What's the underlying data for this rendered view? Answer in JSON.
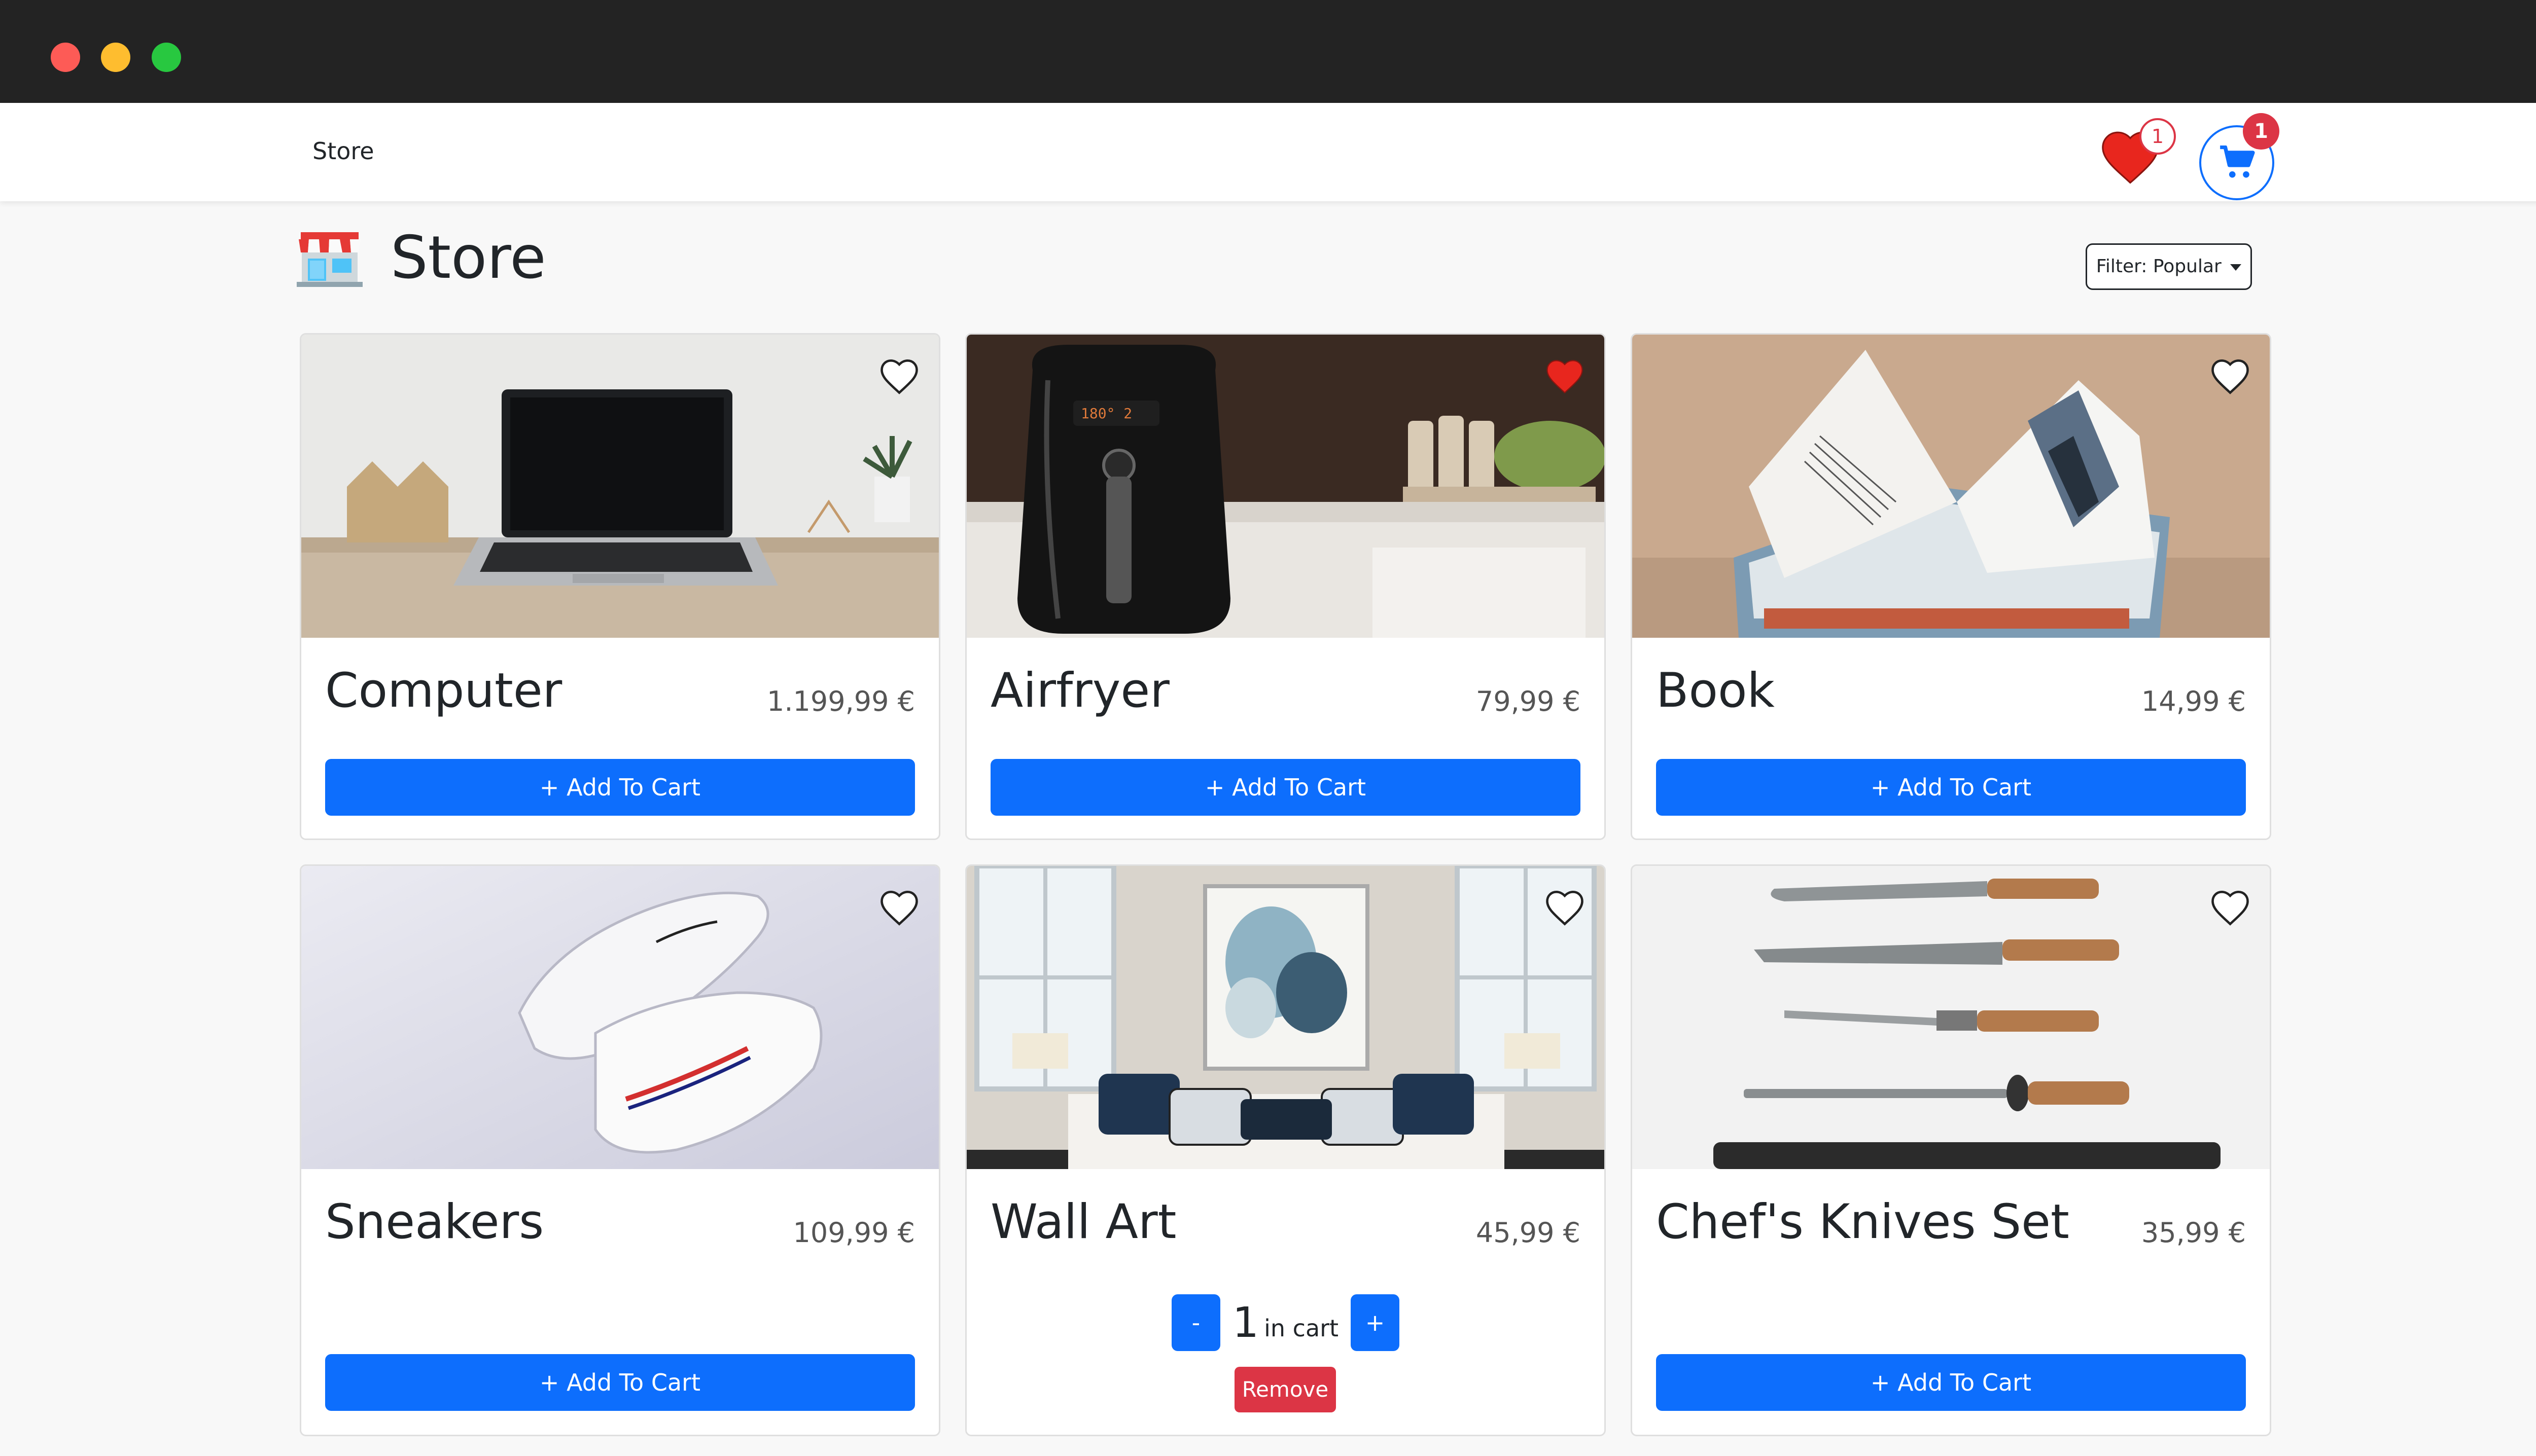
{
  "nav": {
    "link": "Store",
    "favorites_count": "1",
    "cart_count": "1"
  },
  "header": {
    "title": "Store",
    "filter_label": "Filter: Popular"
  },
  "products": [
    {
      "name": "Computer",
      "price": "1.199,99 €",
      "button": "+ Add To Cart",
      "favorite": false,
      "image": "laptop-photo"
    },
    {
      "name": "Airfryer",
      "price": "79,99 €",
      "button": "+ Add To Cart",
      "favorite": true,
      "image": "airfryer-photo"
    },
    {
      "name": "Book",
      "price": "14,99 €",
      "button": "+ Add To Cart",
      "favorite": false,
      "image": "book-photo"
    },
    {
      "name": "Sneakers",
      "price": "109,99 €",
      "button": "+ Add To Cart",
      "favorite": false,
      "image": "sneakers-photo"
    },
    {
      "name": "Wall Art",
      "price": "45,99 €",
      "favorite": false,
      "image": "living-room-photo",
      "cart": {
        "minus": "-",
        "quantity": "1",
        "label": "in cart",
        "plus": "+",
        "remove": "Remove"
      }
    },
    {
      "name": "Chef's Knives Set",
      "price": "35,99 €",
      "button": "+ Add To Cart",
      "favorite": false,
      "image": "knives-photo"
    }
  ],
  "colors": {
    "primary": "#0d6efd",
    "danger": "#dc3545",
    "favorite_red": "#e8261e",
    "titlebar": "#232323"
  },
  "icons": {
    "favorites": "heart-icon",
    "cart": "cart-icon",
    "store": "storefront-icon",
    "favorite_toggle": "heart-outline-icon"
  }
}
